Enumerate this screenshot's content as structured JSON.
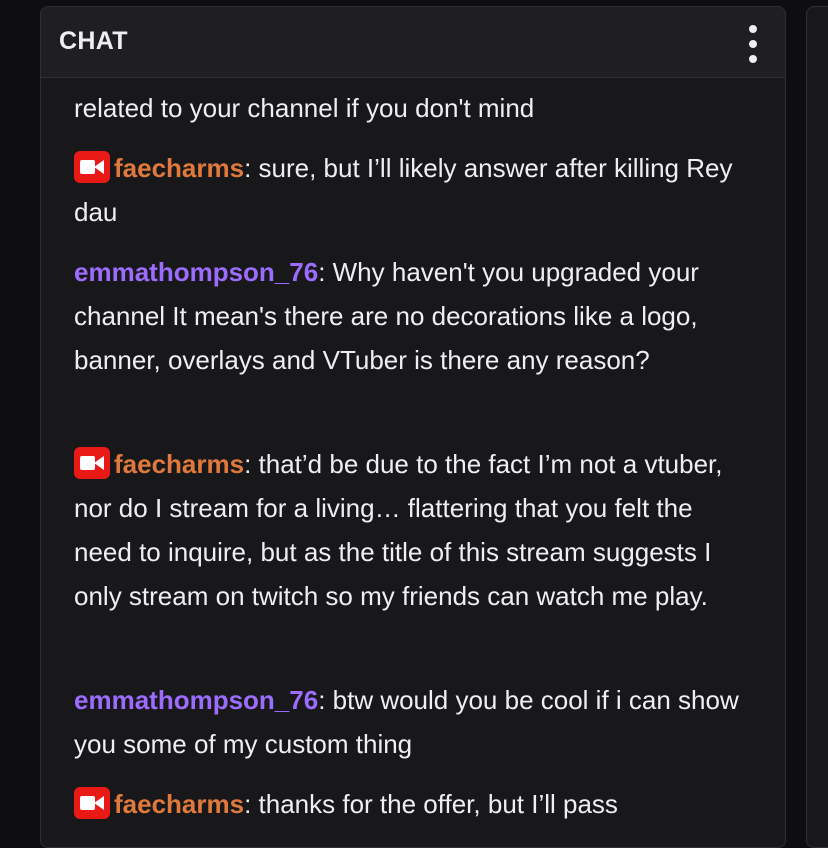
{
  "chat": {
    "title": "CHAT",
    "menu_icon": "kebab-menu-icon"
  },
  "messages": [
    {
      "username": "",
      "text": "related to your channel if you don't mind",
      "badge": null
    },
    {
      "username": "faecharms",
      "text": ": sure, but I’ll likely answer after killing Rey dau",
      "badge": "broadcaster-icon",
      "name_color": "#e0793c"
    },
    {
      "username": "emmathompson_76",
      "text": ": Why haven't you upgraded your channel It mean's there are no decorations like a logo, banner, overlays and VTuber is there any reason?",
      "badge": null,
      "name_color": "#9c6cff"
    },
    {
      "username": "faecharms",
      "text": ": that’d be due to the fact I’m not a vtuber, nor do I stream for a living… flattering that you felt the need to inquire, but as the title of this stream suggests I only stream on twitch so my friends can watch me play.",
      "badge": "broadcaster-icon",
      "name_color": "#e0793c"
    },
    {
      "username": "emmathompson_76",
      "text": ": btw would you be cool if i can show you some of my custom thing",
      "badge": null,
      "name_color": "#9c6cff"
    },
    {
      "username": "faecharms",
      "text": ": thanks for the offer, but I’ll pass",
      "badge": "broadcaster-icon",
      "name_color": "#e0793c"
    }
  ]
}
